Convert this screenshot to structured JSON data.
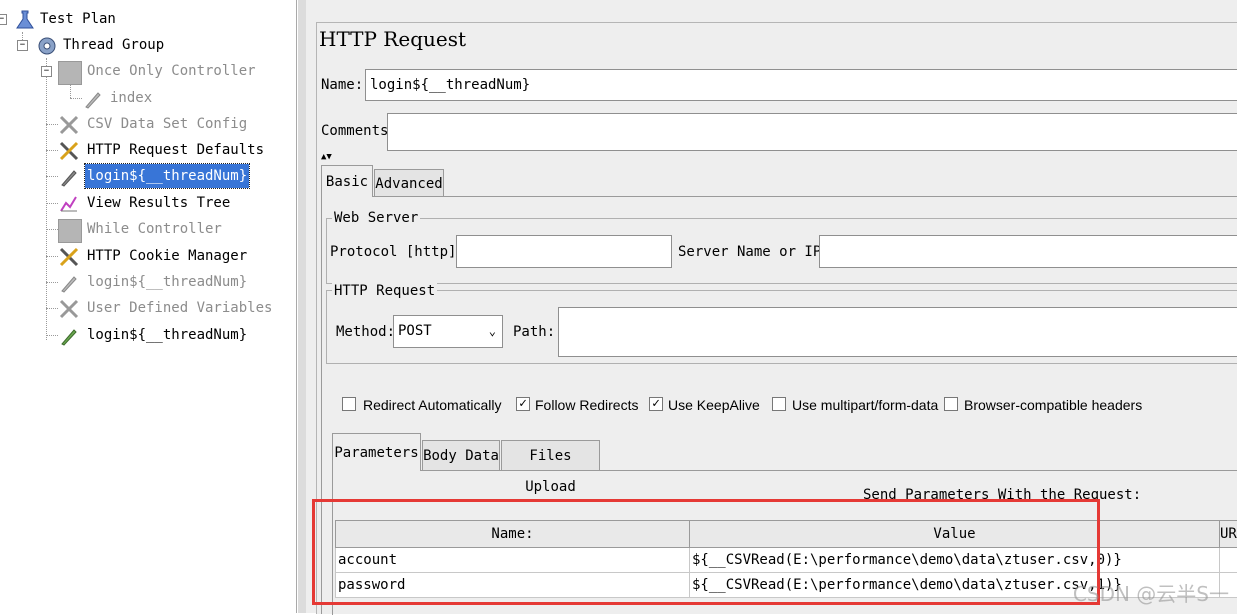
{
  "tree": {
    "nodes": [
      {
        "label": "Test Plan",
        "icon": "test-plan-icon",
        "disabled": false
      },
      {
        "label": "Thread Group",
        "icon": "gear-icon",
        "disabled": false
      },
      {
        "label": "Once Only Controller",
        "icon": "controller-icon",
        "disabled": true
      },
      {
        "label": "index",
        "icon": "pipette-icon",
        "disabled": true
      },
      {
        "label": "CSV Data Set Config",
        "icon": "wrench-icon",
        "disabled": true
      },
      {
        "label": "HTTP Request Defaults",
        "icon": "wrench-icon",
        "disabled": false
      },
      {
        "label": "login${__threadNum}",
        "icon": "pipette-icon",
        "disabled": false,
        "selected": true
      },
      {
        "label": "View Results Tree",
        "icon": "chart-icon",
        "disabled": false
      },
      {
        "label": "While Controller",
        "icon": "controller-icon",
        "disabled": true
      },
      {
        "label": "HTTP Cookie Manager",
        "icon": "wrench-icon",
        "disabled": false
      },
      {
        "label": "login${__threadNum}",
        "icon": "pipette-icon",
        "disabled": true
      },
      {
        "label": "User Defined Variables",
        "icon": "wrench-icon",
        "disabled": true
      },
      {
        "label": "login${__threadNum}",
        "icon": "pipette-icon",
        "disabled": false
      }
    ]
  },
  "panel": {
    "title": "HTTP Request",
    "name_label": "Name:",
    "name_value": "login${__threadNum}",
    "comments_label": "Comments:",
    "comments_value": "",
    "tabs": [
      {
        "label": "Basic",
        "active": true
      },
      {
        "label": "Advanced",
        "active": false
      }
    ],
    "web_server": {
      "legend": "Web Server",
      "protocol_label": "Protocol [http]:",
      "protocol_value": "",
      "server_label": "Server Name or IP:",
      "server_value": ""
    },
    "http_request": {
      "legend": "HTTP Request",
      "method_label": "Method:",
      "method_value": "POST",
      "path_label": "Path:",
      "path_value": ""
    },
    "options": [
      {
        "label": "Redirect Automatically",
        "checked": false
      },
      {
        "label": "Follow Redirects",
        "checked": true
      },
      {
        "label": "Use KeepAlive",
        "checked": true
      },
      {
        "label": "Use multipart/form-data",
        "checked": false
      },
      {
        "label": "Browser-compatible headers",
        "checked": false
      }
    ],
    "subtabs": [
      {
        "label": "Parameters",
        "active": true
      },
      {
        "label": "Body Data",
        "active": false
      },
      {
        "label": "Files Upload",
        "active": false
      }
    ],
    "params_caption": "Send Parameters With the Request:",
    "params_columns": [
      "Name:",
      "Value",
      "URL"
    ],
    "params_rows": [
      {
        "name": "account",
        "value": "${__CSVRead(E:\\performance\\demo\\data\\ztuser.csv,0)}"
      },
      {
        "name": "password",
        "value": "${__CSVRead(E:\\performance\\demo\\data\\ztuser.csv,1)}"
      }
    ]
  },
  "watermark": "CSDN @云半S一",
  "colors": {
    "selection": "#3875d7",
    "highlight_box": "#e53935"
  }
}
